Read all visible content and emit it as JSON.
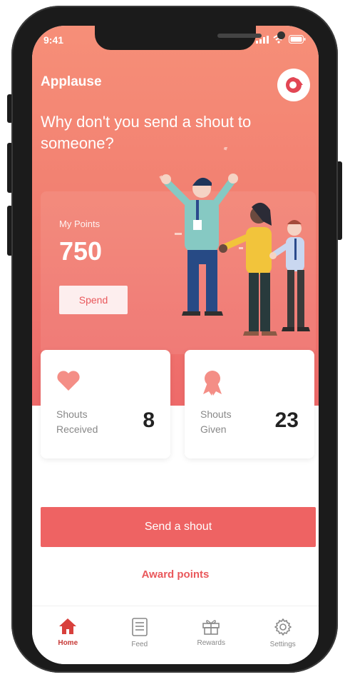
{
  "status_bar": {
    "time": "9:41"
  },
  "header": {
    "app_title": "Applause",
    "logo_icon": "applause-logo-icon"
  },
  "hero": {
    "headline": "Why don't you send a shout to someone?"
  },
  "points": {
    "label": "My Points",
    "value": "750",
    "spend_label": "Spend"
  },
  "stats": [
    {
      "label_line1": "Shouts",
      "label_line2": "Received",
      "value": "8",
      "icon": "heart-icon"
    },
    {
      "label_line1": "Shouts",
      "label_line2": "Given",
      "value": "23",
      "icon": "award-ribbon-icon"
    }
  ],
  "actions": {
    "send_label": "Send a shout",
    "award_label": "Award points"
  },
  "tabs": [
    {
      "label": "Home",
      "icon": "home-icon",
      "active": true
    },
    {
      "label": "Feed",
      "icon": "feed-icon",
      "active": false
    },
    {
      "label": "Rewards",
      "icon": "gift-icon",
      "active": false
    },
    {
      "label": "Settings",
      "icon": "gear-icon",
      "active": false
    }
  ],
  "colors": {
    "accent": "#ee6363",
    "hero_top": "#f68f78",
    "hero_bottom": "#ee6a6a",
    "active_tab": "#c73a37"
  }
}
